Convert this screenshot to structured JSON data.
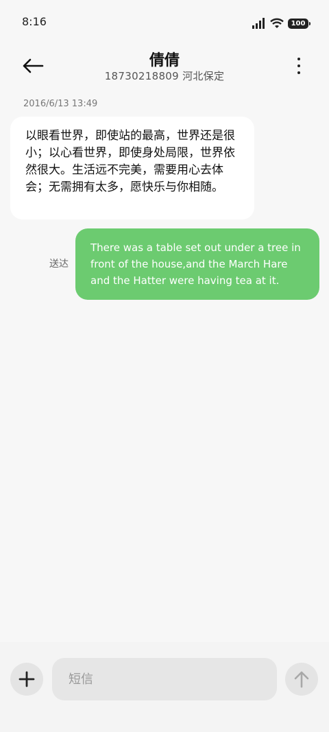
{
  "status_bar": {
    "time": "8:16",
    "battery": "100"
  },
  "header": {
    "contact_name": "倩倩",
    "contact_subtitle": "18730218809 河北保定"
  },
  "conversation": {
    "timestamp": "2016/6/13 13:49",
    "incoming_message": "以眼看世界，即使站的最高，世界还是很小；以心看世界，即使身处局限，世界依然很大。生活远不完美，需要用心去体会；无需拥有太多，愿快乐与你相随。",
    "outgoing_message": "There was a table set out under a tree in front of the house,and the March Hare and the Hatter were having tea at it.",
    "outgoing_status": "送达"
  },
  "composer": {
    "placeholder": "短信"
  },
  "icons": {
    "back": "back-arrow-icon",
    "more": "more-vertical-icon",
    "add": "plus-icon",
    "send": "send-arrow-up-icon"
  },
  "colors": {
    "outgoing_bubble": "#6ccb70",
    "incoming_bubble": "#ffffff"
  }
}
